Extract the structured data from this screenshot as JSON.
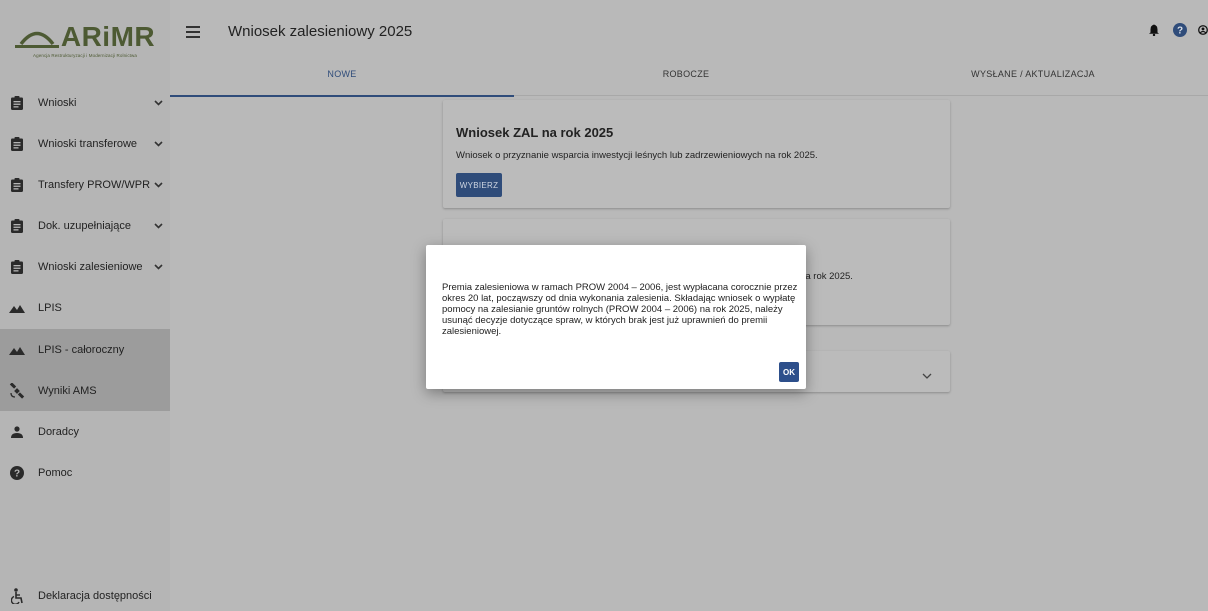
{
  "logo": {
    "text": "ARiMR",
    "subtitle": "Agencja Restrukturyzacji i Modernizacji Rolnictwa"
  },
  "header": {
    "title": "Wniosek zalesieniowy 2025",
    "icons": [
      "bell-icon",
      "help-icon",
      "account-icon"
    ]
  },
  "tabs": [
    {
      "label": "NOWE",
      "active": true
    },
    {
      "label": "ROBOCZE",
      "active": false
    },
    {
      "label": "WYSŁANE / AKTUALIZACJA",
      "active": false
    }
  ],
  "sidebar": {
    "items": [
      {
        "label": "Wnioski",
        "icon": "clipboard-icon",
        "expandable": true
      },
      {
        "label": "Wnioski transferowe",
        "icon": "clipboard-icon",
        "expandable": true
      },
      {
        "label": "Transfery PROW/WPR",
        "icon": "clipboard-icon",
        "expandable": true
      },
      {
        "label": "Dok. uzupełniające",
        "icon": "clipboard-icon",
        "expandable": true
      },
      {
        "label": "Wnioski zalesieniowe",
        "icon": "clipboard-icon",
        "expandable": true
      },
      {
        "label": "LPIS",
        "icon": "terrain-icon",
        "expandable": false
      },
      {
        "label": "LPIS - całoroczny",
        "icon": "terrain-icon",
        "expandable": false
      },
      {
        "label": "Wyniki AMS",
        "icon": "satellite-icon",
        "expandable": false
      },
      {
        "label": "Doradcy",
        "icon": "person-icon",
        "expandable": false
      },
      {
        "label": "Pomoc",
        "icon": "help-icon",
        "expandable": false
      },
      {
        "label": "Deklaracja dostępności",
        "icon": "accessibility-icon",
        "expandable": false
      }
    ]
  },
  "cards": [
    {
      "title": "Wniosek ZAL na rok 2025",
      "description": "Wniosek o przyznanie wsparcia inwestycji leśnych lub zadrzewieniowych na rok 2025.",
      "button_label": "WYBIERZ"
    },
    {
      "partial_text": "5) na rok 2025."
    }
  ],
  "modal": {
    "text": "Premia zalesieniowa w ramach PROW 2004 – 2006, jest wypłacana corocznie przez okres 20 lat, począwszy od dnia wykonania zalesienia. Składając wniosek o wypłatę pomocy na zalesianie gruntów rolnych (PROW 2004 – 2006) na rok 2025, należy usunąć decyzje dotyczące spraw, w których brak jest już uprawnień do premii zalesieniowej.",
    "ok_label": "OK"
  },
  "colors": {
    "primary": "#2f4c7a",
    "ok_button": "#2d4f8b",
    "logo": "#4d5a33",
    "overlay_background": "#b9b9b9"
  }
}
